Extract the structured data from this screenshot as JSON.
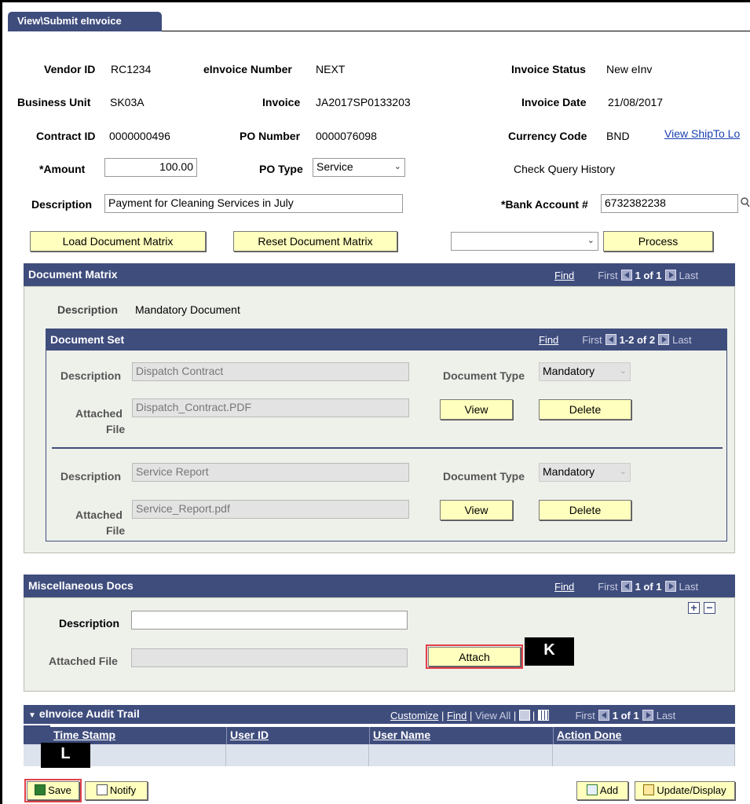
{
  "tab": {
    "title": "View\\Submit eInvoice"
  },
  "header": {
    "vendor_id_label": "Vendor ID",
    "vendor_id": "RC1234",
    "einvoice_number_label": "eInvoice Number",
    "einvoice_number": "NEXT",
    "invoice_status_label": "Invoice Status",
    "invoice_status": "New eInv",
    "business_unit_label": "Business Unit",
    "business_unit": "SK03A",
    "invoice_label": "Invoice",
    "invoice": "JA2017SP0133203",
    "invoice_date_label": "Invoice Date",
    "invoice_date": "21/08/2017",
    "contract_id_label": "Contract ID",
    "contract_id": "0000000496",
    "po_number_label": "PO Number",
    "po_number": "0000076098",
    "currency_code_label": "Currency Code",
    "currency_code": "BND",
    "view_shipto_link": "View ShipTo Lo",
    "amount_label": "*Amount",
    "amount": "100.00",
    "po_type_label": "PO Type",
    "po_type": "Service",
    "check_query_history": "Check Query History",
    "description_label": "Description",
    "description": "Payment for Cleaning Services in July",
    "bank_account_label": "*Bank Account #",
    "bank_account": "6732382238"
  },
  "actions": {
    "load_matrix": "Load Document Matrix",
    "reset_matrix": "Reset Document Matrix",
    "process": "Process",
    "action_select": ""
  },
  "document_matrix": {
    "title": "Document Matrix",
    "find": "Find",
    "first": "First",
    "count": "1 of 1",
    "last": "Last",
    "description_label": "Description",
    "description": "Mandatory Document",
    "document_set": {
      "title": "Document Set",
      "find": "Find",
      "first": "First",
      "count": "1-2 of 2",
      "last": "Last",
      "rows": [
        {
          "description_label": "Description",
          "description": "Dispatch Contract",
          "doc_type_label": "Document Type",
          "doc_type": "Mandatory",
          "attached_label_1": "Attached",
          "attached_label_2": "File",
          "attached_file": "Dispatch_Contract.PDF",
          "view": "View",
          "delete": "Delete"
        },
        {
          "description_label": "Description",
          "description": "Service Report",
          "doc_type_label": "Document Type",
          "doc_type": "Mandatory",
          "attached_label_1": "Attached",
          "attached_label_2": "File",
          "attached_file": "Service_Report.pdf",
          "view": "View",
          "delete": "Delete"
        }
      ]
    }
  },
  "misc_docs": {
    "title": "Miscellaneous Docs",
    "find": "Find",
    "first": "First",
    "count": "1 of 1",
    "last": "Last",
    "description_label": "Description",
    "description": "",
    "attached_label": "Attached File",
    "attached_file": "",
    "attach": "Attach",
    "marker": "K"
  },
  "audit_trail": {
    "title": "eInvoice Audit Trail",
    "customize": "Customize",
    "find": "Find",
    "view_all": "View All",
    "first": "First",
    "count": "1 of 1",
    "last": "Last",
    "columns": [
      "Time Stamp",
      "User ID",
      "User Name",
      "Action Done"
    ],
    "marker": "L"
  },
  "footer": {
    "save": "Save",
    "notify": "Notify",
    "add": "Add",
    "update_display": "Update/Display"
  },
  "colors": {
    "header_bg": "#3f4d7d",
    "button_bg": "#ffffbe",
    "highlight": "#e2404a",
    "link": "#1a3fb0"
  }
}
